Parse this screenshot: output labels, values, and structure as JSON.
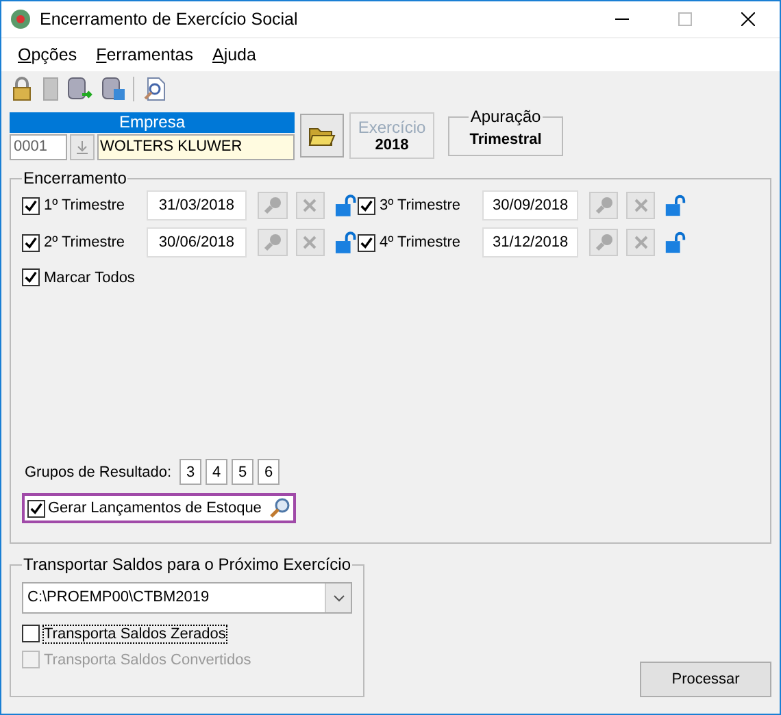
{
  "window": {
    "title": "Encerramento de Exercício Social"
  },
  "menu": [
    "Opções",
    "Ferramentas",
    "Ajuda"
  ],
  "toolbar": [
    {
      "kind": "lock"
    },
    {
      "kind": "blank"
    },
    {
      "kind": "db-arrow"
    },
    {
      "kind": "db-save"
    },
    {
      "kind": "sep"
    },
    {
      "kind": "search-doc"
    }
  ],
  "empresa": {
    "label": "Empresa",
    "code": "0001",
    "name": "WOLTERS KLUWER"
  },
  "exercicio": {
    "label": "Exercício",
    "value": "2018"
  },
  "apuracao": {
    "label": "Apuração",
    "value": "Trimestral"
  },
  "encerramento": {
    "title": "Encerramento",
    "quarters": [
      {
        "label": "1º Trimestre",
        "date": "31/03/2018",
        "checked": true
      },
      {
        "label": "3º Trimestre",
        "date": "30/09/2018",
        "checked": true
      },
      {
        "label": "2º Trimestre",
        "date": "30/06/2018",
        "checked": true
      },
      {
        "label": "4º Trimestre",
        "date": "31/12/2018",
        "checked": true
      }
    ],
    "mark_all": {
      "label": "Marcar Todos",
      "checked": true
    },
    "groups_label": "Grupos de Resultado:",
    "groups": [
      "3",
      "4",
      "5",
      "6"
    ],
    "stock": {
      "label": "Gerar Lançamentos de Estoque",
      "checked": true,
      "highlighted": true
    }
  },
  "transport": {
    "title": "Transportar Saldos para o Próximo Exercício",
    "path": "C:\\PROEMP00\\CTBM2019",
    "options": [
      {
        "label": "Transporta Saldos Zerados",
        "checked": false,
        "disabled": false,
        "focused": true
      },
      {
        "label": "Transporta Saldos Convertidos",
        "checked": false,
        "disabled": true,
        "focused": false
      }
    ]
  },
  "buttons": [
    "Processar"
  ]
}
